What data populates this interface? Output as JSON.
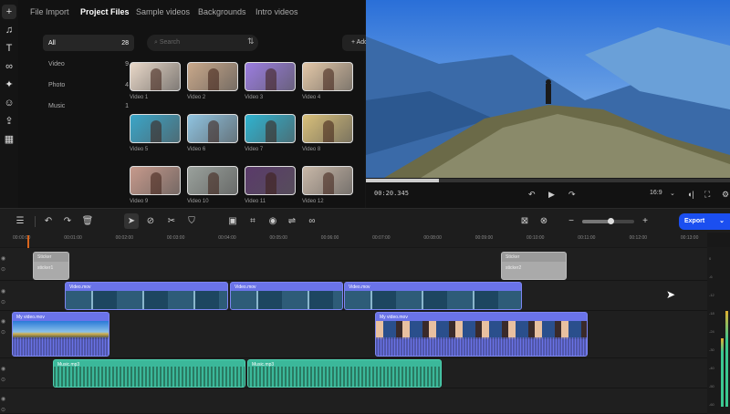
{
  "rail": {
    "icons": [
      "plus-icon",
      "music-icon",
      "text-icon",
      "transition-icon",
      "effects-icon",
      "sticker-icon",
      "export-icon",
      "templates-icon"
    ]
  },
  "media": {
    "tabs": [
      "File Import",
      "Project Files",
      "Sample videos",
      "Backgrounds",
      "Intro videos"
    ],
    "active_tab": 1,
    "categories": [
      {
        "label": "All",
        "count": "28"
      },
      {
        "label": "Video",
        "count": "9"
      },
      {
        "label": "Photo",
        "count": "4"
      },
      {
        "label": "Music",
        "count": "1"
      }
    ],
    "search_placeholder": "Search",
    "add_label": "+ Add",
    "items": [
      {
        "label": "Video 1",
        "color": "#e9d8c8"
      },
      {
        "label": "Video 2",
        "color": "#c9a88a"
      },
      {
        "label": "Video 3",
        "color": "#9b7de0"
      },
      {
        "label": "Video 4",
        "color": "#e4c8a8"
      },
      {
        "label": "Video 5",
        "color": "#3aa6c9"
      },
      {
        "label": "Video 6",
        "color": "#8fc3e0"
      },
      {
        "label": "Video 7",
        "color": "#2fb3d0"
      },
      {
        "label": "Video 8",
        "color": "#d9c07a"
      },
      {
        "label": "Video 9",
        "color": "#c79a8c"
      },
      {
        "label": "Video 10",
        "color": "#9aa19c"
      },
      {
        "label": "Video 11",
        "color": "#5a3a6a"
      },
      {
        "label": "Video 12",
        "color": "#c9b8a8"
      }
    ]
  },
  "preview": {
    "time": "00:20.345",
    "progress": 0.2,
    "aspect": "16:9"
  },
  "toolbar": {
    "export_label": "Export",
    "zoom_level": 0.55
  },
  "ruler": [
    "00:00:00",
    "00:01:00",
    "00:02:00",
    "00:03:00",
    "00:04:00",
    "00:05:00",
    "00:06:00",
    "00:07:00",
    "00:08:00",
    "00:09:00",
    "00:10:00",
    "00:11:00",
    "00:12:00",
    "00:13:00"
  ],
  "clips": {
    "sticker1": {
      "title": "Sticker",
      "sub": "sticker1"
    },
    "sticker2": {
      "title": "Sticker",
      "sub": "sticker2"
    },
    "v1": "Video.mov",
    "v2": "Video.mov",
    "v3": "Video.mov",
    "a1": "My video.mov",
    "a2": "My video.mov",
    "m1": "Music.mp3",
    "m2": "Music.mp3"
  },
  "meter": [
    "0",
    "-6",
    "-12",
    "-18",
    "-24",
    "-30",
    "-40",
    "-50",
    "-60"
  ]
}
